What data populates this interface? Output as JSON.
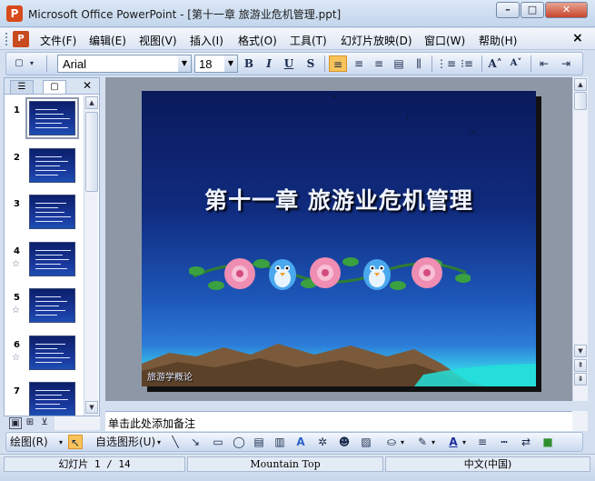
{
  "window": {
    "title": "Microsoft Office PowerPoint - [第十一章  旅游业危机管理.ppt]",
    "app_icon": "powerpoint-icon",
    "controls": [
      "minimize-icon",
      "maximize-icon",
      "close-icon"
    ]
  },
  "menu": {
    "items": [
      "文件(F)",
      "编辑(E)",
      "视图(V)",
      "插入(I)",
      "格式(O)",
      "工具(T)",
      "幻灯片放映(D)",
      "窗口(W)",
      "帮助(H)"
    ],
    "close_glyph": "×"
  },
  "format_toolbar": {
    "font_name": "Arial",
    "font_size": "18",
    "bold": "B",
    "italic": "I",
    "underline": "U",
    "shadow": "S",
    "active_alignment": "align-left"
  },
  "slides_pane": {
    "tabs": [
      "outline-tab",
      "slides-tab"
    ],
    "selected_slide": 1,
    "slides": [
      {
        "number": "1",
        "has_transition_icon": false
      },
      {
        "number": "2",
        "has_transition_icon": false
      },
      {
        "number": "3",
        "has_transition_icon": false
      },
      {
        "number": "4",
        "has_transition_icon": true
      },
      {
        "number": "5",
        "has_transition_icon": true
      },
      {
        "number": "6",
        "has_transition_icon": true
      },
      {
        "number": "7",
        "has_transition_icon": false
      }
    ]
  },
  "slide": {
    "title": "第十一章 旅游业危机管理",
    "footer_text": "旅游学概论"
  },
  "notes": {
    "placeholder": "单击此处添加备注"
  },
  "drawing_toolbar": {
    "draw_label": "绘图(R)",
    "autoshapes_label": "自选图形(U)"
  },
  "status": {
    "slide_position": "幻灯片 1 / 14",
    "design_template": "Mountain Top",
    "language": "中文(中国)"
  },
  "colors": {
    "titlebar": "#c3d6ec",
    "toolbar": "#c9d8ef",
    "active_button": "#f8c35a",
    "editor_background": "#8d97a6",
    "slide_top": "#0a1a5c",
    "slide_bottom": "#35c8e8"
  }
}
